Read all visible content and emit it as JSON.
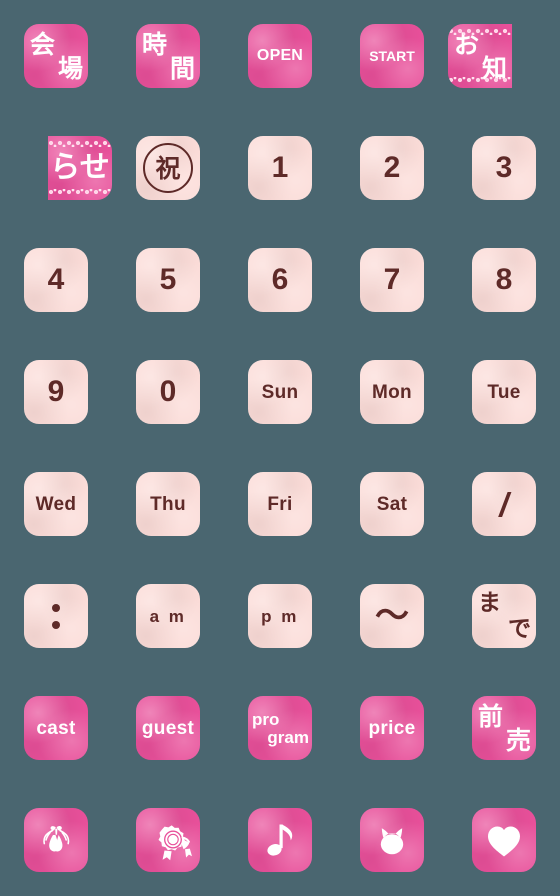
{
  "sheet": {
    "background_color": "#4a6670",
    "tile_dark_color": "#e8509a",
    "tile_light_color": "#fbdcd8",
    "dark_text_color": "#ffffff",
    "light_text_color": "#5e2a28",
    "columns": 5,
    "rows": 8
  },
  "tiles": [
    {
      "id": "kaijou",
      "style": "dark",
      "kind": "stack",
      "chars": [
        "会",
        "場"
      ]
    },
    {
      "id": "jikan",
      "style": "dark",
      "kind": "stack",
      "chars": [
        "時",
        "間"
      ]
    },
    {
      "id": "open",
      "style": "dark",
      "kind": "text",
      "label": "OPEN",
      "size": "sz-small"
    },
    {
      "id": "start",
      "style": "dark",
      "kind": "text",
      "label": "START",
      "size": "sz-tiny"
    },
    {
      "id": "oshi",
      "style": "dark",
      "kind": "stack",
      "chars": [
        "お",
        "知"
      ],
      "lace": true,
      "clip": "right"
    },
    {
      "id": "rase",
      "style": "dark",
      "kind": "text",
      "label": "らせ",
      "size": "sz-big",
      "lace": true,
      "clip": "left"
    },
    {
      "id": "shuku",
      "style": "light",
      "kind": "circled",
      "label": "祝"
    },
    {
      "id": "num1",
      "style": "light",
      "kind": "text",
      "label": "1",
      "size": "sz-big"
    },
    {
      "id": "num2",
      "style": "light",
      "kind": "text",
      "label": "2",
      "size": "sz-big"
    },
    {
      "id": "num3",
      "style": "light",
      "kind": "text",
      "label": "3",
      "size": "sz-big"
    },
    {
      "id": "num4",
      "style": "light",
      "kind": "text",
      "label": "4",
      "size": "sz-big"
    },
    {
      "id": "num5",
      "style": "light",
      "kind": "text",
      "label": "5",
      "size": "sz-big"
    },
    {
      "id": "num6",
      "style": "light",
      "kind": "text",
      "label": "6",
      "size": "sz-big"
    },
    {
      "id": "num7",
      "style": "light",
      "kind": "text",
      "label": "7",
      "size": "sz-big"
    },
    {
      "id": "num8",
      "style": "light",
      "kind": "text",
      "label": "8",
      "size": "sz-big"
    },
    {
      "id": "num9",
      "style": "light",
      "kind": "text",
      "label": "9",
      "size": "sz-big"
    },
    {
      "id": "num0",
      "style": "light",
      "kind": "text",
      "label": "0",
      "size": "sz-big"
    },
    {
      "id": "sun",
      "style": "light",
      "kind": "text",
      "label": "Sun",
      "size": "sz-mid"
    },
    {
      "id": "mon",
      "style": "light",
      "kind": "text",
      "label": "Mon",
      "size": "sz-mid"
    },
    {
      "id": "tue",
      "style": "light",
      "kind": "text",
      "label": "Tue",
      "size": "sz-mid"
    },
    {
      "id": "wed",
      "style": "light",
      "kind": "text",
      "label": "Wed",
      "size": "sz-mid"
    },
    {
      "id": "thu",
      "style": "light",
      "kind": "text",
      "label": "Thu",
      "size": "sz-mid"
    },
    {
      "id": "fri",
      "style": "light",
      "kind": "text",
      "label": "Fri",
      "size": "sz-mid"
    },
    {
      "id": "sat",
      "style": "light",
      "kind": "text",
      "label": "Sat",
      "size": "sz-mid"
    },
    {
      "id": "slash",
      "style": "light",
      "kind": "text",
      "label": "/",
      "size": "sz-slash"
    },
    {
      "id": "colon",
      "style": "light",
      "kind": "colon",
      "label": ":"
    },
    {
      "id": "am",
      "style": "light",
      "kind": "text",
      "label": "a m",
      "size": "sz-amp"
    },
    {
      "id": "pm",
      "style": "light",
      "kind": "text",
      "label": "p m",
      "size": "sz-amp"
    },
    {
      "id": "tilde",
      "style": "light",
      "kind": "tilde",
      "label": "〜"
    },
    {
      "id": "made",
      "style": "light",
      "kind": "stack",
      "chars": [
        "ま",
        "で"
      ],
      "small": true
    },
    {
      "id": "cast",
      "style": "dark",
      "kind": "text",
      "label": "cast",
      "size": "sz-mid"
    },
    {
      "id": "guest",
      "style": "dark",
      "kind": "text",
      "label": "guest",
      "size": "sz-mid"
    },
    {
      "id": "program",
      "style": "dark",
      "kind": "twoline",
      "lines": [
        "pro",
        "gram"
      ]
    },
    {
      "id": "price",
      "style": "dark",
      "kind": "text",
      "label": "price",
      "size": "sz-mid"
    },
    {
      "id": "maeuri",
      "style": "dark",
      "kind": "stack",
      "chars": [
        "前",
        "売"
      ]
    },
    {
      "id": "ballet-shoes",
      "style": "dark",
      "kind": "icon",
      "icon": "ballet-shoes-icon"
    },
    {
      "id": "rosette",
      "style": "dark",
      "kind": "icon",
      "icon": "award-rosette-icon"
    },
    {
      "id": "music-note",
      "style": "dark",
      "kind": "icon",
      "icon": "music-note-icon"
    },
    {
      "id": "cat-face",
      "style": "dark",
      "kind": "icon",
      "icon": "cat-face-icon"
    },
    {
      "id": "heart",
      "style": "dark",
      "kind": "icon",
      "icon": "heart-icon"
    }
  ]
}
